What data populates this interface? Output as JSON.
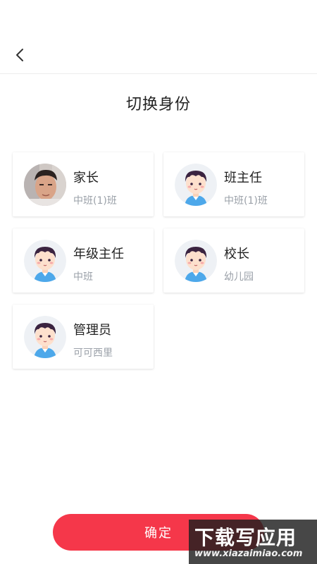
{
  "header": {
    "back_icon": "chevron-left-icon"
  },
  "title": "切换身份",
  "roles": [
    {
      "name": "家长",
      "detail": "中班(1)班",
      "avatar": "photo"
    },
    {
      "name": "班主任",
      "detail": "中班(1)班",
      "avatar": "cartoon"
    },
    {
      "name": "年级主任",
      "detail": "中班",
      "avatar": "cartoon"
    },
    {
      "name": "校长",
      "detail": "幼儿园",
      "avatar": "cartoon"
    },
    {
      "name": "管理员",
      "detail": "可可西里",
      "avatar": "cartoon"
    }
  ],
  "confirm_label": "确定",
  "watermark": {
    "main": "下载写应用",
    "url": "www.xiazaimiao.com"
  },
  "colors": {
    "accent": "#f5374a",
    "subtext": "#9aa0a8",
    "avatar_bg": "#eef1f5",
    "shirt": "#4da8ea",
    "hair": "#3a2340"
  }
}
